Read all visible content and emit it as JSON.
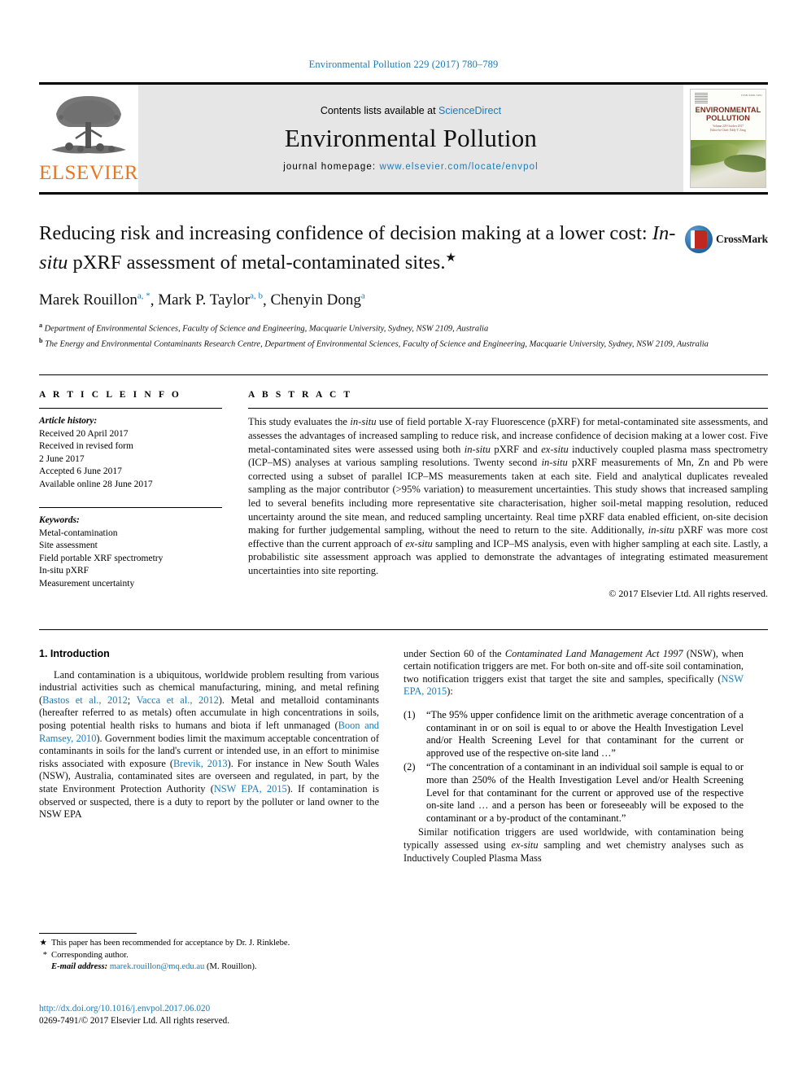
{
  "running_head": "Environmental Pollution 229 (2017) 780–789",
  "masthead": {
    "publisher": "ELSEVIER",
    "contents_prefix": "Contents lists available at ",
    "contents_link": "ScienceDirect",
    "journal_name": "Environmental Pollution",
    "homepage_prefix": "journal homepage: ",
    "homepage_url": "www.elsevier.com/locate/envpol",
    "cover": {
      "title_line1": "ENVIRONMENTAL",
      "title_line2": "POLLUTION",
      "sub_line1": "Volume 229  October 2017",
      "sub_line2": "Editor-in-Chief: Eddy Y. Zeng",
      "issn": "ISSN 0269-7491"
    }
  },
  "article": {
    "title_part1": "Reducing risk and increasing confidence of decision making at a lower cost: ",
    "title_italic": "In-situ",
    "title_part2": " pXRF assessment of metal-contaminated sites.",
    "title_star": "★",
    "crossmark_label": "CrossMark",
    "authors": [
      {
        "name": "Marek Rouillon",
        "sup": "a, *"
      },
      {
        "name": "Mark P. Taylor",
        "sup": "a, b"
      },
      {
        "name": "Chenyin Dong",
        "sup": "a"
      }
    ],
    "affiliations": [
      {
        "mark": "a",
        "text": "Department of Environmental Sciences, Faculty of Science and Engineering, Macquarie University, Sydney, NSW 2109, Australia"
      },
      {
        "mark": "b",
        "text": "The Energy and Environmental Contaminants Research Centre, Department of Environmental Sciences, Faculty of Science and Engineering, Macquarie University, Sydney, NSW 2109, Australia"
      }
    ]
  },
  "article_info": {
    "heading": "A R T I C L E  I N F O",
    "history_label": "Article history:",
    "history": [
      "Received 20 April 2017",
      "Received in revised form",
      "2 June 2017",
      "Accepted 6 June 2017",
      "Available online 28 June 2017"
    ],
    "keywords_label": "Keywords:",
    "keywords": [
      "Metal-contamination",
      "Site assessment",
      "Field portable XRF spectrometry",
      "In-situ pXRF",
      "Measurement uncertainty"
    ]
  },
  "abstract": {
    "heading": "A B S T R A C T",
    "paragraph_html": "This study evaluates the <i>in-situ</i> use of field portable X-ray Fluorescence (pXRF) for metal-contaminated site assessments, and assesses the advantages of increased sampling to reduce risk, and increase confidence of decision making at a lower cost. Five metal-contaminated sites were assessed using both <i>in-situ</i> pXRF and <i>ex-situ</i> inductively coupled plasma mass spectrometry (ICP–MS) analyses at various sampling resolutions. Twenty second <i>in-situ</i> pXRF measurements of Mn, Zn and Pb were corrected using a subset of parallel ICP–MS measurements taken at each site. Field and analytical duplicates revealed sampling as the major contributor (&gt;95% variation) to measurement uncertainties. This study shows that increased sampling led to several benefits including more representative site characterisation, higher soil-metal mapping resolution, reduced uncertainty around the site mean, and reduced sampling uncertainty. Real time pXRF data enabled efficient, on-site decision making for further judgemental sampling, without the need to return to the site. Additionally, <i>in-situ</i> pXRF was more cost effective than the current approach of <i>ex-situ</i> sampling and ICP–MS analysis, even with higher sampling at each site. Lastly, a probabilistic site assessment approach was applied to demonstrate the advantages of integrating estimated measurement uncertainties into site reporting.",
    "copyright": "© 2017 Elsevier Ltd. All rights reserved."
  },
  "introduction": {
    "heading": "1. Introduction",
    "left_paragraph_html": "Land contamination is a ubiquitous, worldwide problem resulting from various industrial activities such as chemical manufacturing, mining, and metal refining (<span class=\"cite\">Bastos et al., 2012</span>; <span class=\"cite\">Vacca et al., 2012</span>). Metal and metalloid contaminants (hereafter referred to as metals) often accumulate in high concentrations in soils, posing potential health risks to humans and biota if left unmanaged (<span class=\"cite\">Boon and Ramsey, 2010</span>). Government bodies limit the maximum acceptable concentration of contaminants in soils for the land's current or intended use, in an effort to minimise risks associated with exposure (<span class=\"cite\">Brevik, 2013</span>). For instance in New South Wales (NSW), Australia, contaminated sites are overseen and regulated, in part, by the state Environment Protection Authority (<span class=\"cite\">NSW EPA, 2015</span>). If contamination is observed or suspected, there is a duty to report by the polluter or land owner to the NSW EPA",
    "right_paragraph_html": "under Section 60 of the <i>Contaminated Land Management Act 1997</i> (NSW), when certain notification triggers are met. For both on-site and off-site soil contamination, two notification triggers exist that target the site and samples, specifically (<span class=\"cite\">NSW EPA, 2015</span>):",
    "triggers": [
      {
        "marker": "(1)",
        "text": "“The 95% upper confidence limit on the arithmetic average concentration of a contaminant in or on soil is equal to or above the Health Investigation Level and/or Health Screening Level for that contaminant for the current or approved use of the respective on-site land …”"
      },
      {
        "marker": "(2)",
        "text": "“The concentration of a contaminant in an individual soil sample is equal to or more than 250% of the Health Investigation Level and/or Health Screening Level for that contaminant for the current or approved use of the respective on-site land … and a person has been or foreseeably will be exposed to the contaminant or a by-product of the contaminant.”"
      }
    ],
    "right_paragraph2_html": "Similar notification triggers are used worldwide, with contamination being typically assessed using <i>ex-situ</i> sampling and wet chemistry analyses such as Inductively Coupled Plasma Mass"
  },
  "footnotes": {
    "star_mark": "★",
    "star_text": "This paper has been recommended for acceptance by Dr. J. Rinklebe.",
    "corr_mark": "*",
    "corr_text": "Corresponding author.",
    "email_label": "E-mail address:",
    "email": "marek.rouillon@mq.edu.au",
    "email_suffix": " (M. Rouillon)."
  },
  "doi_block": {
    "doi": "http://dx.doi.org/10.1016/j.envpol.2017.06.020",
    "issn_copyright": "0269-7491/© 2017 Elsevier Ltd. All rights reserved."
  },
  "colors": {
    "link_blue": "#1a7bb9",
    "elsevier_orange": "#E87722",
    "band_gray": "#e6e6e6",
    "cover_maroon": "#7a2b1e"
  }
}
